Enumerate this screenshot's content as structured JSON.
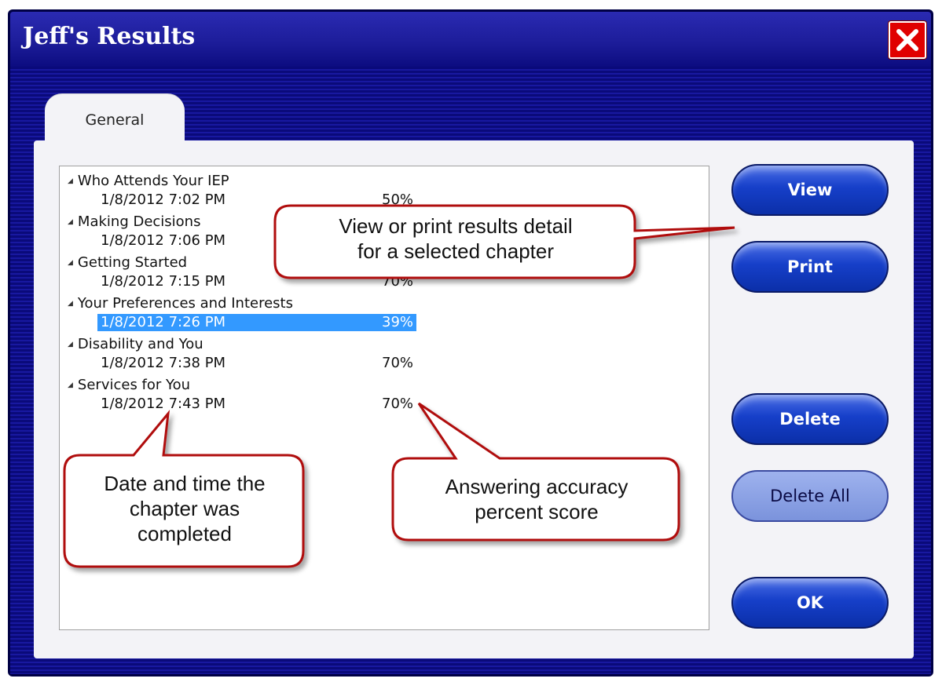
{
  "window": {
    "title": "Jeff's Results"
  },
  "tabs": [
    {
      "label": "General"
    }
  ],
  "results": [
    {
      "chapter": "Who Attends Your IEP",
      "date": "1/8/2012 7:02 PM",
      "score": "50%"
    },
    {
      "chapter": "Making Decisions",
      "date": "1/8/2012 7:06 PM",
      "score": ""
    },
    {
      "chapter": "Getting Started",
      "date": "1/8/2012 7:15 PM",
      "score": "70%"
    },
    {
      "chapter": "Your Preferences and Interests",
      "date": "1/8/2012 7:26 PM",
      "score": "39%"
    },
    {
      "chapter": "Disability and You",
      "date": "1/8/2012 7:38 PM",
      "score": "70%"
    },
    {
      "chapter": "Services for You",
      "date": "1/8/2012 7:43 PM",
      "score": "70%"
    }
  ],
  "selected_index": 3,
  "buttons": {
    "view": "View",
    "print": "Print",
    "delete": "Delete",
    "delete_all": "Delete All",
    "ok": "OK"
  },
  "callouts": {
    "view_print": [
      "View or print results detail",
      "for a selected chapter"
    ],
    "date_time": [
      "Date and time the",
      "chapter was",
      "completed"
    ],
    "accuracy": [
      "Answering accuracy",
      "percent score"
    ]
  },
  "colors": {
    "window_bg": "#0a0a7a",
    "close_button": "#e00000",
    "selection": "#3399ff",
    "callout_border": "#b01010"
  }
}
